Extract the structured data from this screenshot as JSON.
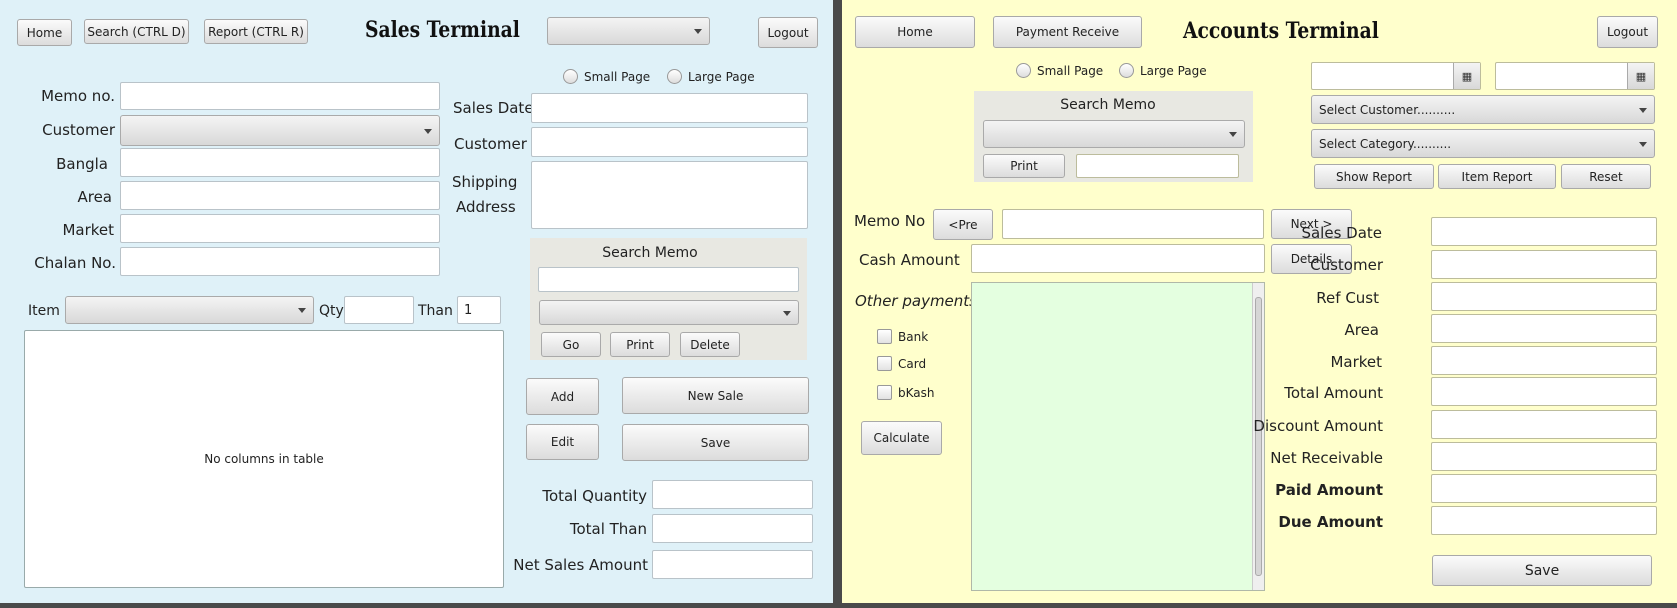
{
  "sales": {
    "home": "Home",
    "search": "Search (CTRL D)",
    "report": "Report (CTRL R)",
    "title": "Sales Terminal",
    "logout": "Logout",
    "small_page": "Small Page",
    "large_page": "Large Page",
    "memo_no": "Memo no.",
    "customer": "Customer",
    "bangla": "Bangla",
    "area": "Area",
    "market": "Market",
    "chalan_no": "Chalan No.",
    "sales_date": "Sales Date",
    "customer_right": "Customer",
    "shipping": "Shipping",
    "address": "Address",
    "search_memo": "Search Memo",
    "go": "Go",
    "print": "Print",
    "delete": "Delete",
    "item": "Item",
    "qty": "Qty",
    "than": "Than",
    "than_value": "1",
    "table_empty": "No columns in table",
    "add": "Add",
    "new_sale": "New Sale",
    "edit": "Edit",
    "save": "Save",
    "total_quantity": "Total Quantity",
    "total_than": "Total Than",
    "net_sales_amount": "Net Sales Amount"
  },
  "accounts": {
    "home": "Home",
    "payment_receive": "Payment Receive",
    "title": "Accounts Terminal",
    "logout": "Logout",
    "small_page": "Small Page",
    "large_page": "Large Page",
    "search_memo": "Search Memo",
    "print": "Print",
    "select_customer": "Select Customer..........",
    "select_category": "Select Category..........",
    "show_report": "Show Report",
    "item_report": "Item Report",
    "reset": "Reset",
    "memo_no": "Memo No",
    "pre": "<Pre",
    "next": "Next >",
    "cash_amount": "Cash Amount",
    "details": "Details",
    "other_payments": "Other payments",
    "bank": "Bank",
    "card": "Card",
    "bkash": "bKash",
    "calculate": "Calculate",
    "sales_date": "Sales Date",
    "customer": "Customer",
    "ref_cust": "Ref Cust",
    "area": "Area",
    "market": "Market",
    "total_amount": "Total Amount",
    "discount_amount": "Discount Amount",
    "net_receivable": "Net Receivable",
    "paid_amount": "Paid Amount",
    "due_amount": "Due Amount",
    "save": "Save"
  },
  "icons": {
    "calendar": "calendar-icon",
    "dropdown": "chevron-down-icon"
  },
  "colors": {
    "sales_bg": "#dff1f8",
    "accounts_bg": "#ffffcc",
    "payments_area": "#e4ffe0"
  }
}
